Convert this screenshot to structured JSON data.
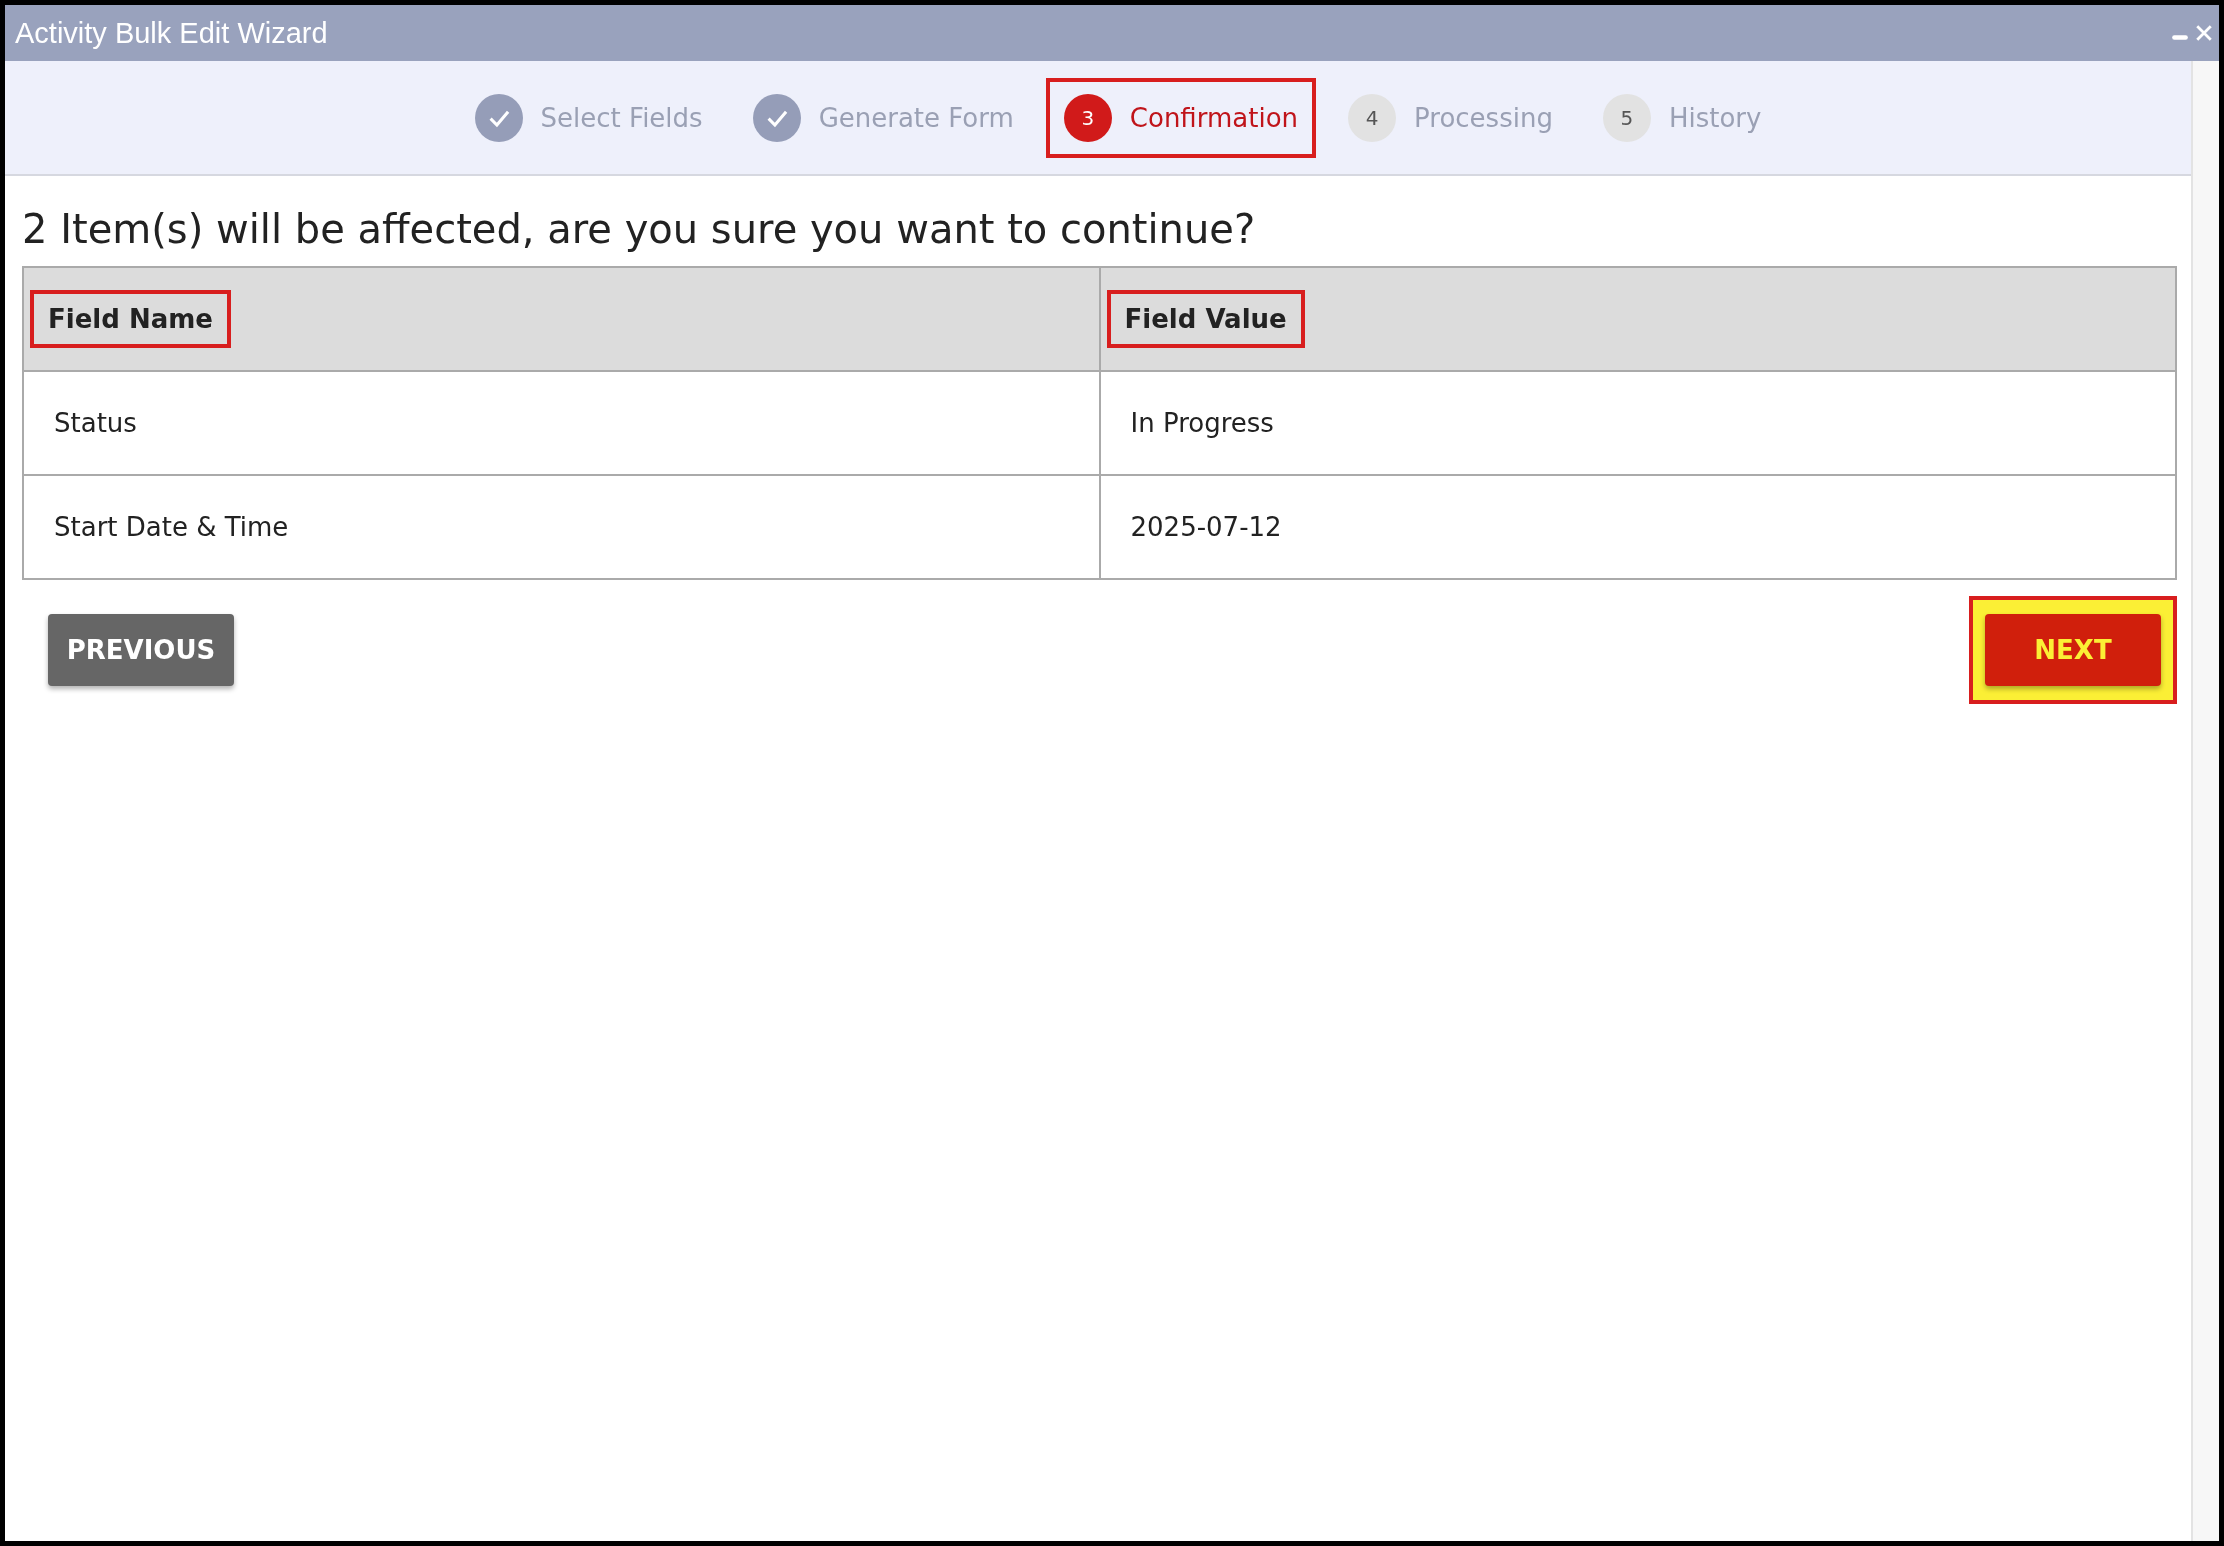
{
  "window": {
    "title": "Activity Bulk Edit Wizard"
  },
  "steps": [
    {
      "label": "Select Fields",
      "kind": "done",
      "selected": false,
      "highlighted": false
    },
    {
      "label": "Generate Form",
      "kind": "done",
      "selected": false,
      "highlighted": false
    },
    {
      "number": "3",
      "label": "Confirmation",
      "kind": "numbered",
      "selected": true,
      "highlighted": true
    },
    {
      "number": "4",
      "label": "Processing",
      "kind": "numbered",
      "selected": false,
      "highlighted": false
    },
    {
      "number": "5",
      "label": "History",
      "kind": "numbered",
      "selected": false,
      "highlighted": false
    }
  ],
  "heading": "2 Item(s) will be affected, are you sure you want to continue?",
  "table": {
    "columns": [
      {
        "label": "Field Name",
        "highlighted": true
      },
      {
        "label": "Field Value",
        "highlighted": true
      }
    ],
    "rows": [
      [
        "Status",
        "In Progress"
      ],
      [
        "Start Date & Time",
        "2025-07-12"
      ]
    ]
  },
  "buttons": {
    "previous": {
      "label": "PREVIOUS",
      "highlighted": false
    },
    "next": {
      "label": "NEXT",
      "highlighted": true
    }
  }
}
